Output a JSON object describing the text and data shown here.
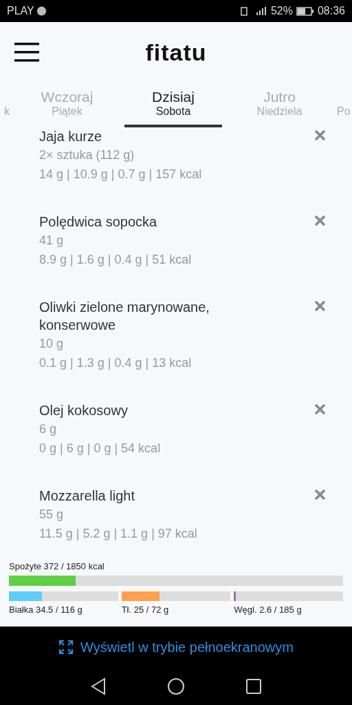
{
  "status_bar": {
    "carrier": "PLAY",
    "battery": "52%",
    "time": "08:36"
  },
  "header": {
    "logo": "fitatu"
  },
  "tabs": [
    {
      "sublabel": "k",
      "selected": false
    },
    {
      "label": "Wczoraj",
      "sublabel": "Piątek",
      "selected": false
    },
    {
      "label": "Dzisiaj",
      "sublabel": "Sobota",
      "selected": true
    },
    {
      "label": "Jutro",
      "sublabel": "Niedziela",
      "selected": false
    },
    {
      "sublabel": "Po",
      "selected": false
    }
  ],
  "items": [
    {
      "name": "Jaja kurze",
      "amount": "2× sztuka (112 g)",
      "macros": "14 g | 10.9 g | 0.7 g | 157 kcal"
    },
    {
      "name": "Polędwica sopocka",
      "amount": "41 g",
      "macros": "8.9 g | 1.6 g | 0.4 g | 51 kcal"
    },
    {
      "name": "Oliwki zielone marynowane, konserwowe",
      "amount": "10 g",
      "macros": "0.1 g | 1.3 g | 0.4 g | 13 kcal"
    },
    {
      "name": "Olej kokosowy",
      "amount": "6 g",
      "macros": "0 g | 6 g | 0 g | 54 kcal"
    },
    {
      "name": "Mozzarella light",
      "amount": "55 g",
      "macros": "11.5 g | 5.2 g | 1.1 g | 97 kcal"
    }
  ],
  "summary": {
    "total": {
      "label": "Spożyte 372 / 1850 kcal",
      "level": 0.2,
      "color": "#5fcf47"
    },
    "macros": [
      {
        "label": "Białka 34.5 / 116 g",
        "level": 0.3,
        "color": "#5fcdfa"
      },
      {
        "label": "Tł. 25 / 72 g",
        "level": 0.35,
        "color": "#ffa04f"
      },
      {
        "label": "Węgl. 2.6 / 185 g",
        "level": 0.014,
        "color": "#9e6cc0"
      }
    ]
  },
  "banner": {
    "label": "Wyświetl w trybie pełnoekranowym"
  }
}
